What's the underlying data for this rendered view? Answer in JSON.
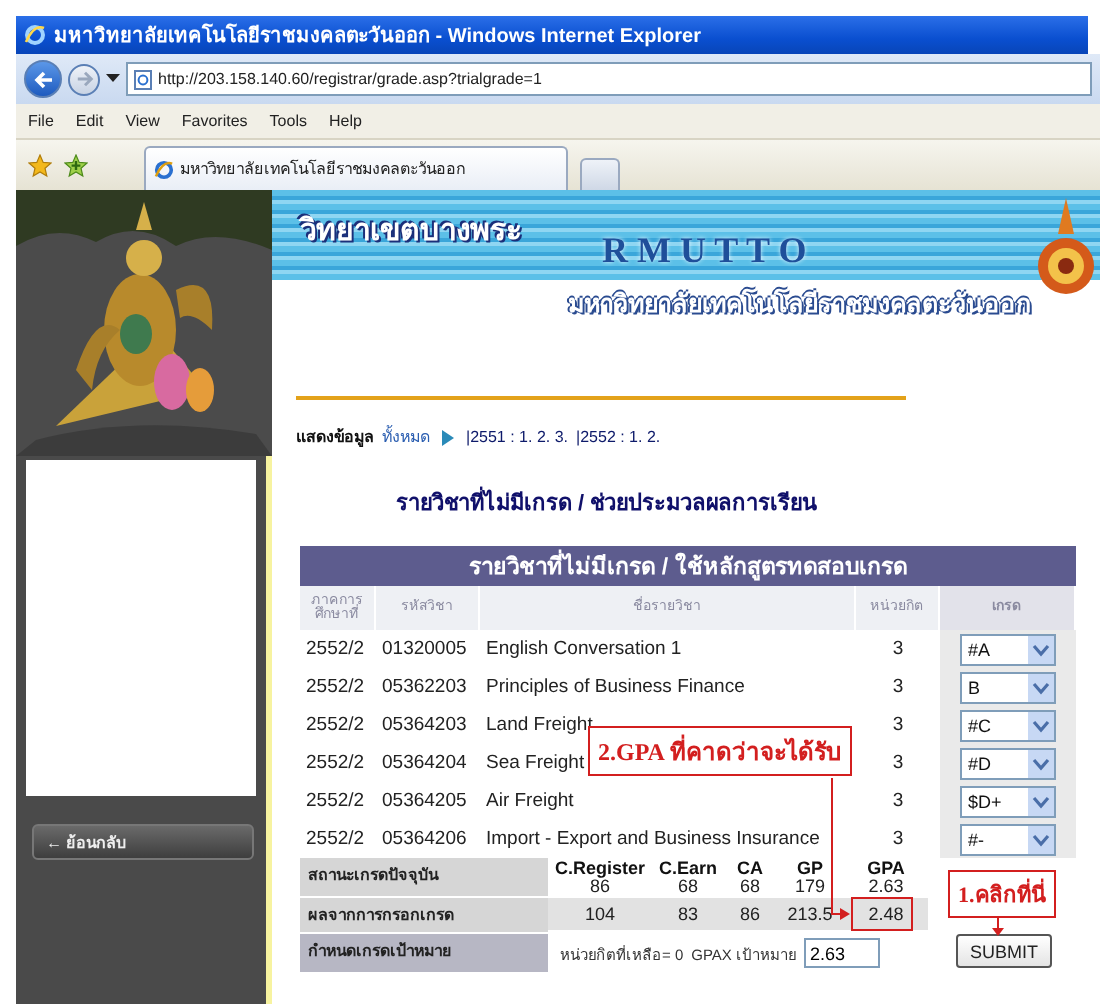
{
  "window": {
    "title": "มหาวิทยาลัยเทคโนโลยีราชมงคลตะวันออก - Windows Internet Explorer"
  },
  "address_bar": {
    "url": "http://203.158.140.60/registrar/grade.asp?trialgrade=1"
  },
  "menu": [
    "File",
    "Edit",
    "View",
    "Favorites",
    "Tools",
    "Help"
  ],
  "tabs": [
    {
      "label": "มหาวิทยาลัยเทคโนโลยีราชมงคลตะวันออก",
      "selected": true
    }
  ],
  "sidebar": {
    "back_button": "← ย้อนกลับ"
  },
  "banner": {
    "campus": "วิทยาเขตบางพระ",
    "acronym": "R M U T T O",
    "university": "มหาวิทยาลัยเทคโนโลยีราชมงคลตะวันออก"
  },
  "filter": {
    "label": "แสดงข้อมูล",
    "links": [
      {
        "label": "ทั้งหมด",
        "selected": true
      },
      {
        "label": "|2551 : 1. 2. 3.",
        "selected": false
      },
      {
        "label": "|2552 : 1. 2.",
        "selected": false
      }
    ]
  },
  "heading": "รายวิชาที่ไม่มีเกรด / ช่วยประมวลผลการเรียน",
  "table": {
    "title": "รายวิชาที่ไม่มีเกรด / ใช้หลักสูตรทดสอบเกรด",
    "columns": [
      "ภาคการศึกษาที่",
      "รหัสวิชา",
      "ชื่อรายวิชา",
      "หน่วยกิต",
      "เกรด"
    ],
    "rows": [
      {
        "term": "2552/2",
        "code": "01320005",
        "name": "English Conversation 1",
        "credits": "3",
        "grade": "#A"
      },
      {
        "term": "2552/2",
        "code": "05362203",
        "name": "Principles of Business Finance",
        "credits": "3",
        "grade": "B"
      },
      {
        "term": "2552/2",
        "code": "05364203",
        "name": "Land Freight",
        "credits": "3",
        "grade": "#C"
      },
      {
        "term": "2552/2",
        "code": "05364204",
        "name": "Sea Freight",
        "credits": "3",
        "grade": "#D"
      },
      {
        "term": "2552/2",
        "code": "05364205",
        "name": "Air Freight",
        "credits": "3",
        "grade": "$D+"
      },
      {
        "term": "2552/2",
        "code": "05364206",
        "name": "Import - Export and Business Insurance",
        "credits": "3",
        "grade": "#-"
      }
    ]
  },
  "summary": {
    "columns": [
      "C.Register",
      "C.Earn",
      "CA",
      "GP",
      "GPA"
    ],
    "rows": [
      {
        "label": "สถานะเกรดปัจจุบัน",
        "values": [
          "86",
          "68",
          "68",
          "179",
          "2.63"
        ]
      },
      {
        "label": "ผลจากการกรอกเกรด",
        "values": [
          "104",
          "83",
          "86",
          "213.5",
          "2.48"
        ]
      }
    ],
    "target": {
      "label": "กำหนดเกรดเป้าหมาย",
      "remaining": "หน่วยกิตที่เหลือ= 0",
      "gpax_label": "GPAX เป้าหมาย",
      "gpax_value": "2.63",
      "submit": "SUBMIT"
    }
  },
  "annotations": [
    {
      "text": "2.GPA ที่คาดว่าจะได้รับ"
    },
    {
      "text": "1.คลิกที่นี่"
    }
  ]
}
